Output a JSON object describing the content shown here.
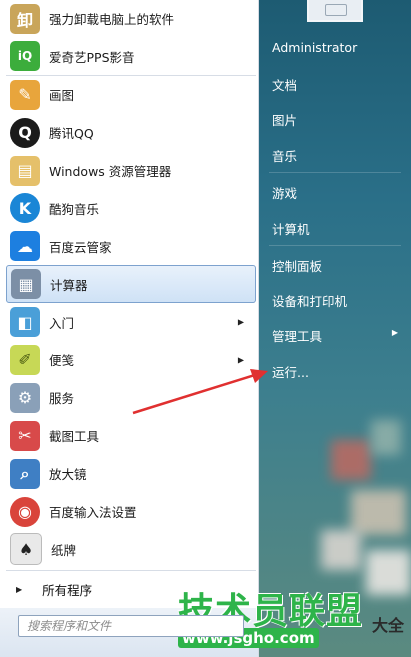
{
  "programs": [
    {
      "label": "强力卸载电脑上的软件",
      "icon": "uninstall-box-icon",
      "color": "#c9a55a",
      "glyph": "卸"
    },
    {
      "label": "爱奇艺PPS影音",
      "icon": "iqiyi-pps-icon",
      "color": "#3cad3c",
      "glyph": "iQ"
    },
    {
      "label": "画图",
      "icon": "paint-palette-icon",
      "color": "#e8a53c",
      "glyph": "✎"
    },
    {
      "label": "腾讯QQ",
      "icon": "qq-penguin-icon",
      "color": "#1b1b1b",
      "glyph": "Q"
    },
    {
      "label": "Windows 资源管理器",
      "icon": "folder-explorer-icon",
      "color": "#e5c06a",
      "glyph": "▤"
    },
    {
      "label": "酷狗音乐",
      "icon": "kugou-icon",
      "color": "#1a86d6",
      "glyph": "K"
    },
    {
      "label": "百度云管家",
      "icon": "baidu-cloud-icon",
      "color": "#1d7fe0",
      "glyph": "☁"
    },
    {
      "label": "计算器",
      "icon": "calculator-icon",
      "color": "#7c8fa6",
      "glyph": "▦"
    },
    {
      "label": "入门",
      "icon": "getting-started-icon",
      "color": "#4a9fd8",
      "glyph": "◧"
    },
    {
      "label": "便笺",
      "icon": "sticky-notes-icon",
      "color": "#c7d856",
      "glyph": "✐"
    },
    {
      "label": "服务",
      "icon": "services-gear-icon",
      "color": "#8aa0b8",
      "glyph": "⚙"
    },
    {
      "label": "截图工具",
      "icon": "snipping-tool-icon",
      "color": "#d84a4a",
      "glyph": "✂"
    },
    {
      "label": "放大镜",
      "icon": "magnifier-icon",
      "color": "#3f7fc4",
      "glyph": "⌕"
    },
    {
      "label": "百度输入法设置",
      "icon": "baidu-ime-icon",
      "color": "#d9443b",
      "glyph": "◉"
    },
    {
      "label": "纸牌",
      "icon": "solitaire-cards-icon",
      "color": "#e9e9e9",
      "glyph": "♠"
    }
  ],
  "all_programs_label": "所有程序",
  "search": {
    "placeholder": "搜索程序和文件"
  },
  "right_menu": [
    "Administrator",
    "文档",
    "图片",
    "音乐",
    "游戏",
    "计算机",
    "控制面板",
    "设备和打印机",
    "管理工具",
    "运行..."
  ],
  "watermark": {
    "title": "技术员联盟",
    "url": "www.jsgho.com",
    "suffix": "大全"
  },
  "colors": {
    "accent": "#7da2ce",
    "annotation": "#e03030",
    "watermark_green": "#2eb44a"
  }
}
